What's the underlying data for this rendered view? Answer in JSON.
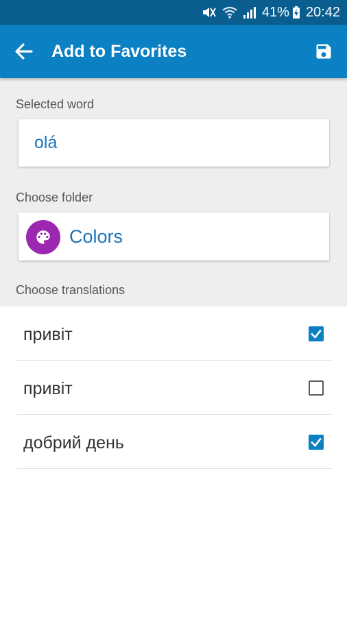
{
  "status_bar": {
    "battery": "41%",
    "time": "20:42",
    "icons": [
      "mute-icon",
      "wifi-icon",
      "signal-icon",
      "battery-charging-icon"
    ]
  },
  "app_bar": {
    "title": "Add to Favorites",
    "back_icon": "arrow-left-icon",
    "save_icon": "save-icon",
    "color": "#0b80c2"
  },
  "selected_word": {
    "label": "Selected word",
    "value": "olá"
  },
  "folder": {
    "label": "Choose folder",
    "name": "Colors",
    "icon": "palette-icon",
    "icon_color": "#9c27b0"
  },
  "translations": {
    "label": "Choose translations",
    "items": [
      {
        "text": "привіт",
        "checked": true
      },
      {
        "text": "привіт",
        "checked": false
      },
      {
        "text": "добрий день",
        "checked": true
      }
    ]
  }
}
